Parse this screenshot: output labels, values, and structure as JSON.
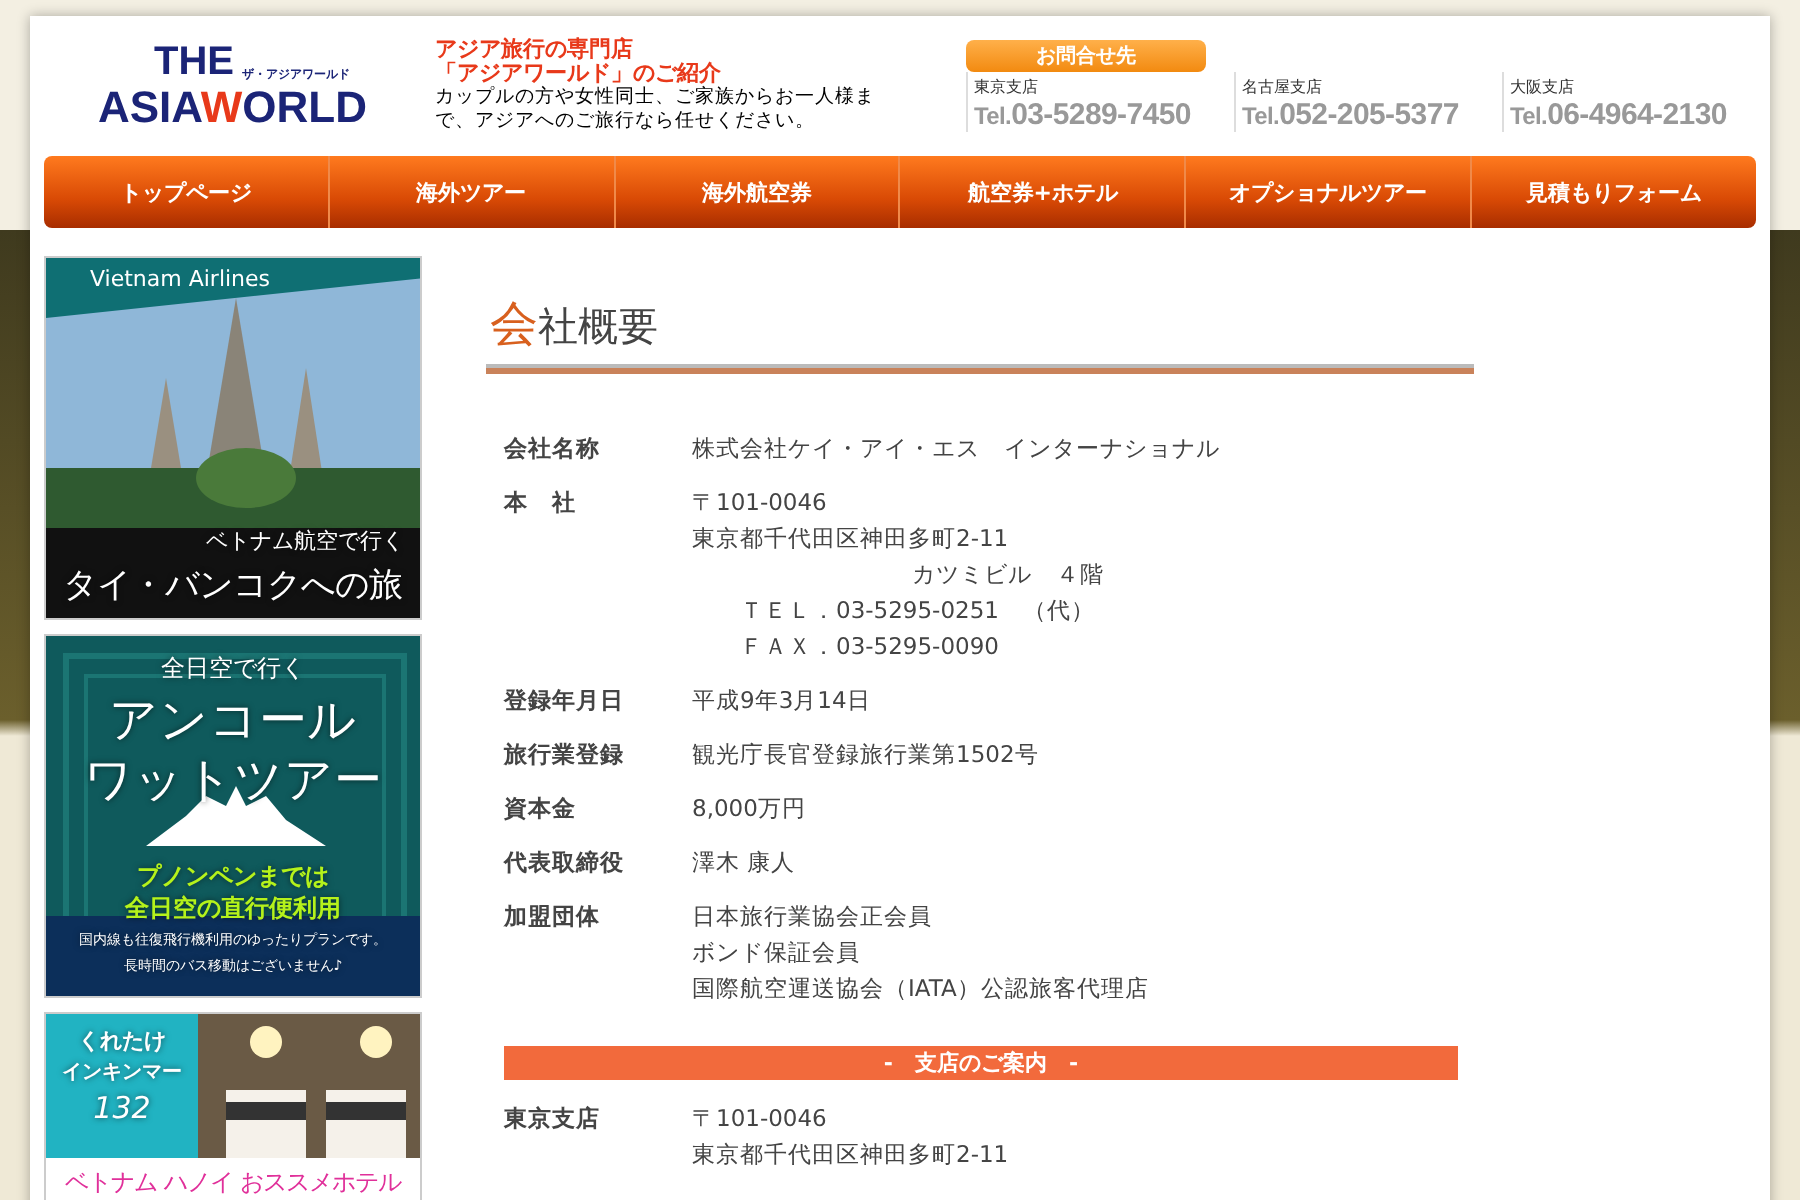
{
  "header": {
    "logo": {
      "top": "THE",
      "main_left": "ASIA",
      "main_accent": "W",
      "main_right": "ORLD",
      "kana": "ザ・アジアワールド"
    },
    "tagline": {
      "title_lines": [
        "アジア旅行の専門店",
        "「アジアワールド」のご紹介"
      ],
      "text": "カップルの方や女性同士、ご家族からお一人様まで、アジアへのご旅行なら任せください。"
    },
    "contact": {
      "label": "お問合せ先",
      "branches": [
        {
          "name": "東京支店",
          "prefix": "Tel.",
          "phone": "03-5289-7450"
        },
        {
          "name": "名古屋支店",
          "prefix": "Tel.",
          "phone": "052-205-5377"
        },
        {
          "name": "大阪支店",
          "prefix": "Tel.",
          "phone": "06-4964-2130"
        }
      ]
    }
  },
  "nav": [
    {
      "label": "トップページ",
      "selected": false
    },
    {
      "label": "海外ツアー",
      "selected": false
    },
    {
      "label": "海外航空券",
      "selected": false
    },
    {
      "label": "航空券+ホテル",
      "selected": false
    },
    {
      "label": "オプショナルツアー",
      "selected": false
    },
    {
      "label": "見積もりフォーム",
      "selected": false
    }
  ],
  "banners": [
    {
      "kind": "temple",
      "brand": "Vietnam Airlines",
      "lines": [
        "ベトナム航空で行く",
        "タイ・バンコクへの旅"
      ]
    },
    {
      "kind": "ruins",
      "lines": [
        "全日空で行く",
        "アンコール",
        "ワットツアー",
        "プノンペンまでは",
        "全日空の直行便利用",
        "国内線も往復飛行機利用のゆったりプランです。",
        "長時間のバス移動はございません♪"
      ]
    },
    {
      "kind": "hotel",
      "lines": [
        "くれたけ",
        "インキンマー",
        "132",
        "ベトナム ハノイ おススメホテル"
      ]
    }
  ],
  "page_title": {
    "accent": "会",
    "rest": "社概要"
  },
  "profile": [
    {
      "label": "会社名称",
      "lines": [
        "株式会社ケイ・アイ・エス　インターナショナル"
      ]
    },
    {
      "label": "本　社",
      "lines": [
        "〒101-0046",
        "東京都千代田区神田多町2-11",
        "カツミビル　４階",
        "ＴＥＬ．03-5295-0251　（代）",
        "ＦＡＸ．03-5295-0090"
      ]
    },
    {
      "label": "登録年月日",
      "lines": [
        "平成9年3月14日"
      ]
    },
    {
      "label": "旅行業登録",
      "lines": [
        "観光庁長官登録旅行業第1502号"
      ]
    },
    {
      "label": "資本金",
      "lines": [
        "8,000万円"
      ]
    },
    {
      "label": "代表取締役",
      "lines": [
        "澤木 康人"
      ]
    },
    {
      "label": "加盟団体",
      "lines": [
        "日本旅行業協会正会員",
        "ボンド保証会員",
        "国際航空運送協会（IATA）公認旅客代理店"
      ]
    }
  ],
  "branches_heading": "-　支店のご案内　-",
  "branch_list": [
    {
      "label": "東京支店",
      "lines": [
        "〒101-0046",
        "東京都千代田区神田多町2-11"
      ]
    }
  ]
}
